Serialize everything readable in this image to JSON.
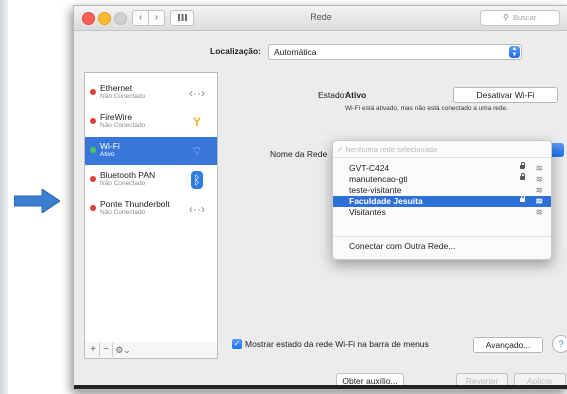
{
  "window": {
    "title": "Rede",
    "search_placeholder": "Buscar"
  },
  "location": {
    "label": "Localização:",
    "value": "Automática"
  },
  "services": [
    {
      "name": "Ethernet",
      "status": "Não Conectado",
      "dot": "#e0403a",
      "icon": "ethernet-arrows-icon",
      "selected": false
    },
    {
      "name": "FireWire",
      "status": "Não Conectado",
      "dot": "#e0403a",
      "icon": "firewire-icon",
      "selected": false
    },
    {
      "name": "Wi-Fi",
      "status": "Ativo",
      "dot": "#4cc457",
      "icon": "wifi-icon",
      "selected": true
    },
    {
      "name": "Bluetooth PAN",
      "status": "Não Conectado",
      "dot": "#e0403a",
      "icon": "bluetooth-icon",
      "selected": false
    },
    {
      "name": "Ponte Thunderbolt",
      "status": "Não Conectado",
      "dot": "#e0403a",
      "icon": "thunderbolt-arrows-icon",
      "selected": false
    }
  ],
  "toolbar": {
    "add": "+",
    "remove": "−",
    "action": "⚙⌄"
  },
  "status": {
    "label": "Estado:",
    "value": "Ativo",
    "description": "Wi-Fi está ativado, mas não está conectado a uma rede.",
    "wifi_off_button": "Desativar Wi-Fi"
  },
  "network_name": {
    "label": "Nome da Rede",
    "none_option": "✓ Nenhuma rede selecionada",
    "networks": [
      {
        "name": "GVT-C424",
        "locked": true,
        "active": false
      },
      {
        "name": "manutencao-gti",
        "locked": true,
        "active": false
      },
      {
        "name": "teste-visitante",
        "locked": false,
        "active": false
      },
      {
        "name": "Faculdade Jesuita",
        "locked": true,
        "active": true
      },
      {
        "name": "Visitantes",
        "locked": false,
        "active": false
      }
    ],
    "other_network": "Conectar com Outra Rede..."
  },
  "show_wifi_status": {
    "checked": true,
    "label": "Mostrar estado da rede Wi-Fi na barra de menus"
  },
  "buttons": {
    "advanced": "Avançado...",
    "help": "?",
    "assist": "Obter auxílio...",
    "revert": "Reverter",
    "apply": "Aplicar"
  },
  "colors": {
    "accent": "#3877d9",
    "arrow": "#3c7fd0"
  }
}
